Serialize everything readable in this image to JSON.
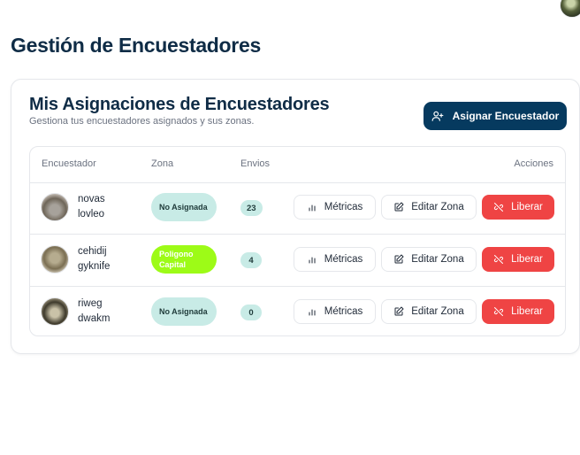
{
  "page": {
    "title": "Gestión de Encuestadores"
  },
  "card": {
    "title": "Mis Asignaciones de Encuestadores",
    "subtitle": "Gestiona tus encuestadores asignados y sus zonas.",
    "assign_button_label": "Asignar Encuestador",
    "assign_icon": "user-plus-icon"
  },
  "table": {
    "headers": {
      "encuestador": "Encuestador",
      "zona": "Zona",
      "envios": "Envios",
      "acciones": "Acciones"
    },
    "action_labels": {
      "metricas": "Métricas",
      "editar": "Editar Zona",
      "liberar": "Liberar"
    },
    "action_icons": {
      "metricas": "bar-chart-icon",
      "editar": "edit-icon",
      "liberar": "link-off-icon"
    },
    "rows": [
      {
        "first": "novas",
        "last": "lovleo",
        "zone": "No Asignada",
        "zone_status": "none",
        "envios": "23"
      },
      {
        "first": "cehidij",
        "last": "gyknife",
        "zone": "Poligono Capital",
        "zone_status": "assigned",
        "envios": "4"
      },
      {
        "first": "riweg",
        "last": "dwakm",
        "zone": "No Asignada",
        "zone_status": "none",
        "envios": "0"
      }
    ]
  },
  "colors": {
    "primary": "#063a5f",
    "danger": "#ef4444",
    "zone_unassigned_bg": "#c8ebe6",
    "zone_assigned_bg": "#9dfb17"
  }
}
